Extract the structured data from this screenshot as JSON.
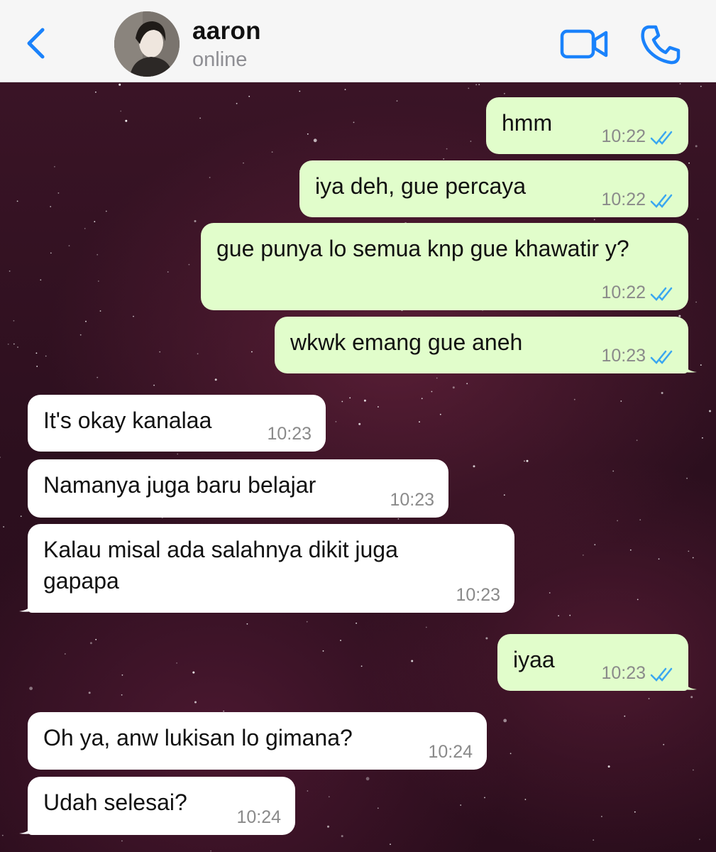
{
  "header": {
    "back_icon": "chevron-left-icon",
    "contact_name": "aaron",
    "contact_status": "online",
    "video_icon": "video-camera-icon",
    "call_icon": "phone-icon",
    "accent_color": "#1a82fb"
  },
  "chat": {
    "outgoing_bubble_color": "#e1fdcb",
    "incoming_bubble_color": "#ffffff",
    "read_tick_color": "#3aa7f0",
    "messages": [
      {
        "direction": "out",
        "text": "hmm",
        "time": "10:22",
        "status": "read"
      },
      {
        "direction": "out",
        "text": "iya deh, gue percaya",
        "time": "10:22",
        "status": "read"
      },
      {
        "direction": "out",
        "text": "gue punya lo semua knp gue khawatir y?",
        "time": "10:22",
        "status": "read"
      },
      {
        "direction": "out",
        "text": "wkwk emang gue aneh",
        "time": "10:23",
        "status": "read"
      },
      {
        "direction": "in",
        "text": "It's okay kanalaa",
        "time": "10:23"
      },
      {
        "direction": "in",
        "text": "Namanya juga baru belajar",
        "time": "10:23"
      },
      {
        "direction": "in",
        "text": "Kalau misal ada salahnya dikit juga gapapa",
        "time": "10:23"
      },
      {
        "direction": "out",
        "text": "iyaa",
        "time": "10:23",
        "status": "read"
      },
      {
        "direction": "in",
        "text": "Oh ya, anw lukisan lo gimana?",
        "time": "10:24"
      },
      {
        "direction": "in",
        "text": "Udah selesai?",
        "time": "10:24"
      }
    ]
  }
}
